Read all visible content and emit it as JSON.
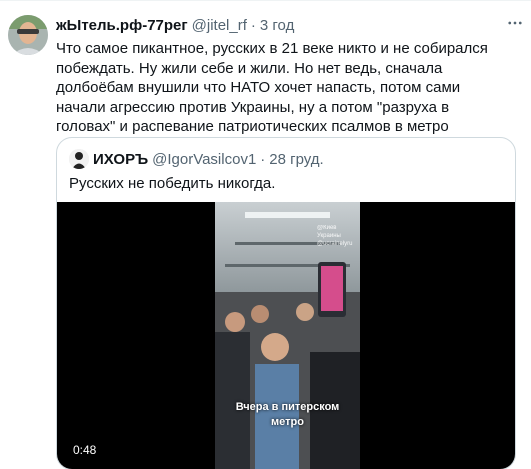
{
  "tweet": {
    "author_name": "жЫтель.рф-77рег",
    "author_handle": "@jitel_rf",
    "separator": "·",
    "time": "3 год",
    "text": "Что самое пикантное, русских в 21 веке никто и не собирался побеждать. Ну жили себе и жили. Но нет ведь, сначала долбоёбам внушили что НАТО хочет напасть, потом сами начали агрессию против Украины, ну а потом \"разруха в головах\" и распевание патриотических псалмов в метро",
    "more_icon": "more-horizontal-icon"
  },
  "quote": {
    "author_name": "ИХОРЪ",
    "author_handle": "@IgorVasilcov1",
    "separator": "·",
    "time": "28 груд.",
    "text": "Русских не победить никогда.",
    "video": {
      "caption_line1": "Вчера в питерском",
      "caption_line2": "метро",
      "watermark_line1": "@Киев Украины",
      "watermark_line2": "@ucrainelyru",
      "duration": "0:48"
    }
  },
  "colors": {
    "text": "#0f1419",
    "secondary": "#536471",
    "border": "#cfd9de",
    "video_bg": "#000000"
  }
}
